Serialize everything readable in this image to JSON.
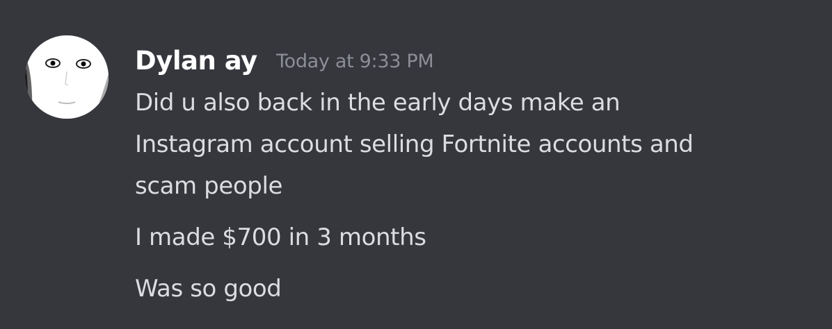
{
  "message": {
    "avatar_icon": "person-avatar-icon",
    "author": "Dylan ay",
    "timestamp": "Today at 9:33 PM",
    "messages": [
      {
        "lines": [
          "Did u also back in the early days make an",
          "Instagram account selling Fortnite accounts and",
          "scam people"
        ]
      },
      {
        "lines": [
          "I made $700 in 3 months"
        ]
      },
      {
        "lines": [
          "Was so good"
        ]
      }
    ]
  },
  "colors": {
    "background": "#36373d",
    "username": "#ffffff",
    "timestamp": "#8d8f96",
    "text": "#dcdde0"
  }
}
